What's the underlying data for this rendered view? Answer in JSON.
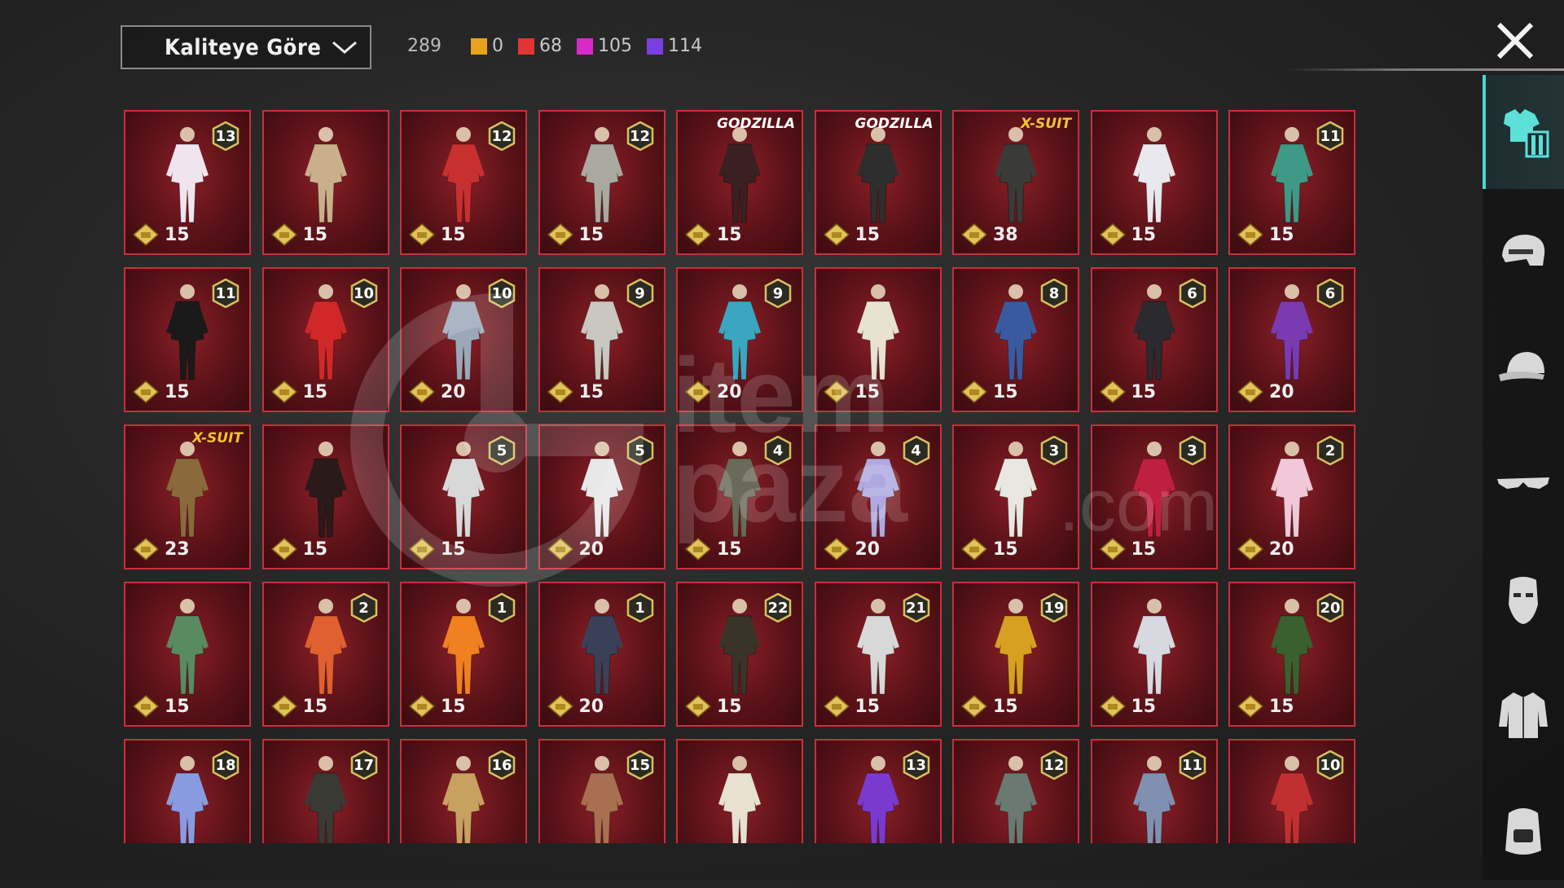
{
  "toolbar": {
    "sort_label": "Kaliteye Göre",
    "total": "289",
    "counts": [
      {
        "value": "0",
        "color": "#e8a21e"
      },
      {
        "value": "68",
        "color": "#e23434"
      },
      {
        "value": "105",
        "color": "#d82ac8"
      },
      {
        "value": "114",
        "color": "#7b3ee0"
      }
    ]
  },
  "watermark": {
    "line1": "item",
    "line2": "paza",
    "suffix": ".com"
  },
  "sidebar": {
    "items": [
      {
        "icon": "outfit-icon",
        "active": true
      },
      {
        "icon": "helmet-icon",
        "active": false
      },
      {
        "icon": "cap-icon",
        "active": false
      },
      {
        "icon": "glasses-icon",
        "active": false
      },
      {
        "icon": "mask-icon",
        "active": false
      },
      {
        "icon": "jacket-icon",
        "active": false
      },
      {
        "icon": "backpack-icon",
        "active": false
      }
    ]
  },
  "items": [
    {
      "level": "13",
      "tag": "",
      "cost": "15",
      "tint": "#f0e4ee"
    },
    {
      "level": "",
      "tag": "",
      "cost": "15",
      "tint": "#c9b08a"
    },
    {
      "level": "12",
      "tag": "",
      "cost": "15",
      "tint": "#c83030"
    },
    {
      "level": "12",
      "tag": "",
      "cost": "15",
      "tint": "#a9a9a0"
    },
    {
      "level": "",
      "tag": "GODZILLA",
      "cost": "15",
      "tint": "#3a2020"
    },
    {
      "level": "",
      "tag": "GODZILLA",
      "cost": "15",
      "tint": "#2e2e2e"
    },
    {
      "level": "",
      "tag": "X-SUIT",
      "cost": "38",
      "tint": "#3a3a38"
    },
    {
      "level": "",
      "tag": "",
      "cost": "15",
      "tint": "#e8e8ee"
    },
    {
      "level": "11",
      "tag": "",
      "cost": "15",
      "tint": "#3e9a86"
    },
    {
      "level": "11",
      "tag": "",
      "cost": "15",
      "tint": "#1a1a1a"
    },
    {
      "level": "10",
      "tag": "",
      "cost": "15",
      "tint": "#d02828"
    },
    {
      "level": "10",
      "tag": "",
      "cost": "20",
      "tint": "#9aa8b8"
    },
    {
      "level": "9",
      "tag": "",
      "cost": "15",
      "tint": "#c8c8c0"
    },
    {
      "level": "9",
      "tag": "",
      "cost": "20",
      "tint": "#3aa6c0"
    },
    {
      "level": "",
      "tag": "",
      "cost": "15",
      "tint": "#e8e2d0"
    },
    {
      "level": "8",
      "tag": "",
      "cost": "15",
      "tint": "#3a5aa0"
    },
    {
      "level": "6",
      "tag": "",
      "cost": "15",
      "tint": "#2a2a30"
    },
    {
      "level": "6",
      "tag": "",
      "cost": "20",
      "tint": "#7a3ab0"
    },
    {
      "level": "",
      "tag": "X-SUIT",
      "cost": "23",
      "tint": "#8a6a3a"
    },
    {
      "level": "",
      "tag": "",
      "cost": "15",
      "tint": "#2a1a1a"
    },
    {
      "level": "5",
      "tag": "",
      "cost": "15",
      "tint": "#d8d8d8"
    },
    {
      "level": "5",
      "tag": "",
      "cost": "20",
      "tint": "#e8e8e8"
    },
    {
      "level": "4",
      "tag": "",
      "cost": "15",
      "tint": "#6a6a58"
    },
    {
      "level": "4",
      "tag": "",
      "cost": "20",
      "tint": "#b0a8e0"
    },
    {
      "level": "3",
      "tag": "",
      "cost": "15",
      "tint": "#e8e8e0"
    },
    {
      "level": "3",
      "tag": "",
      "cost": "15",
      "tint": "#c02040"
    },
    {
      "level": "2",
      "tag": "",
      "cost": "20",
      "tint": "#f0c8d8"
    },
    {
      "level": "",
      "tag": "",
      "cost": "15",
      "tint": "#5a8a60"
    },
    {
      "level": "2",
      "tag": "",
      "cost": "15",
      "tint": "#e06030"
    },
    {
      "level": "1",
      "tag": "",
      "cost": "15",
      "tint": "#f08020"
    },
    {
      "level": "1",
      "tag": "",
      "cost": "20",
      "tint": "#3a4058"
    },
    {
      "level": "22",
      "tag": "",
      "cost": "15",
      "tint": "#3a3428"
    },
    {
      "level": "21",
      "tag": "",
      "cost": "15",
      "tint": "#d8d8d8"
    },
    {
      "level": "19",
      "tag": "",
      "cost": "15",
      "tint": "#d8a020"
    },
    {
      "level": "",
      "tag": "",
      "cost": "15",
      "tint": "#d8d8e0"
    },
    {
      "level": "20",
      "tag": "",
      "cost": "15",
      "tint": "#3a6030"
    },
    {
      "level": "18",
      "tag": "",
      "cost": "",
      "tint": "#8a9ae0"
    },
    {
      "level": "17",
      "tag": "",
      "cost": "",
      "tint": "#3a3a34"
    },
    {
      "level": "16",
      "tag": "",
      "cost": "",
      "tint": "#c8a060"
    },
    {
      "level": "15",
      "tag": "",
      "cost": "",
      "tint": "#a87050"
    },
    {
      "level": "",
      "tag": "",
      "cost": "",
      "tint": "#e8e0d0"
    },
    {
      "level": "13",
      "tag": "",
      "cost": "",
      "tint": "#7a3ad0"
    },
    {
      "level": "12",
      "tag": "",
      "cost": "",
      "tint": "#6a7a70"
    },
    {
      "level": "11",
      "tag": "",
      "cost": "",
      "tint": "#8090b0"
    },
    {
      "level": "10",
      "tag": "",
      "cost": "",
      "tint": "#c03030"
    }
  ]
}
